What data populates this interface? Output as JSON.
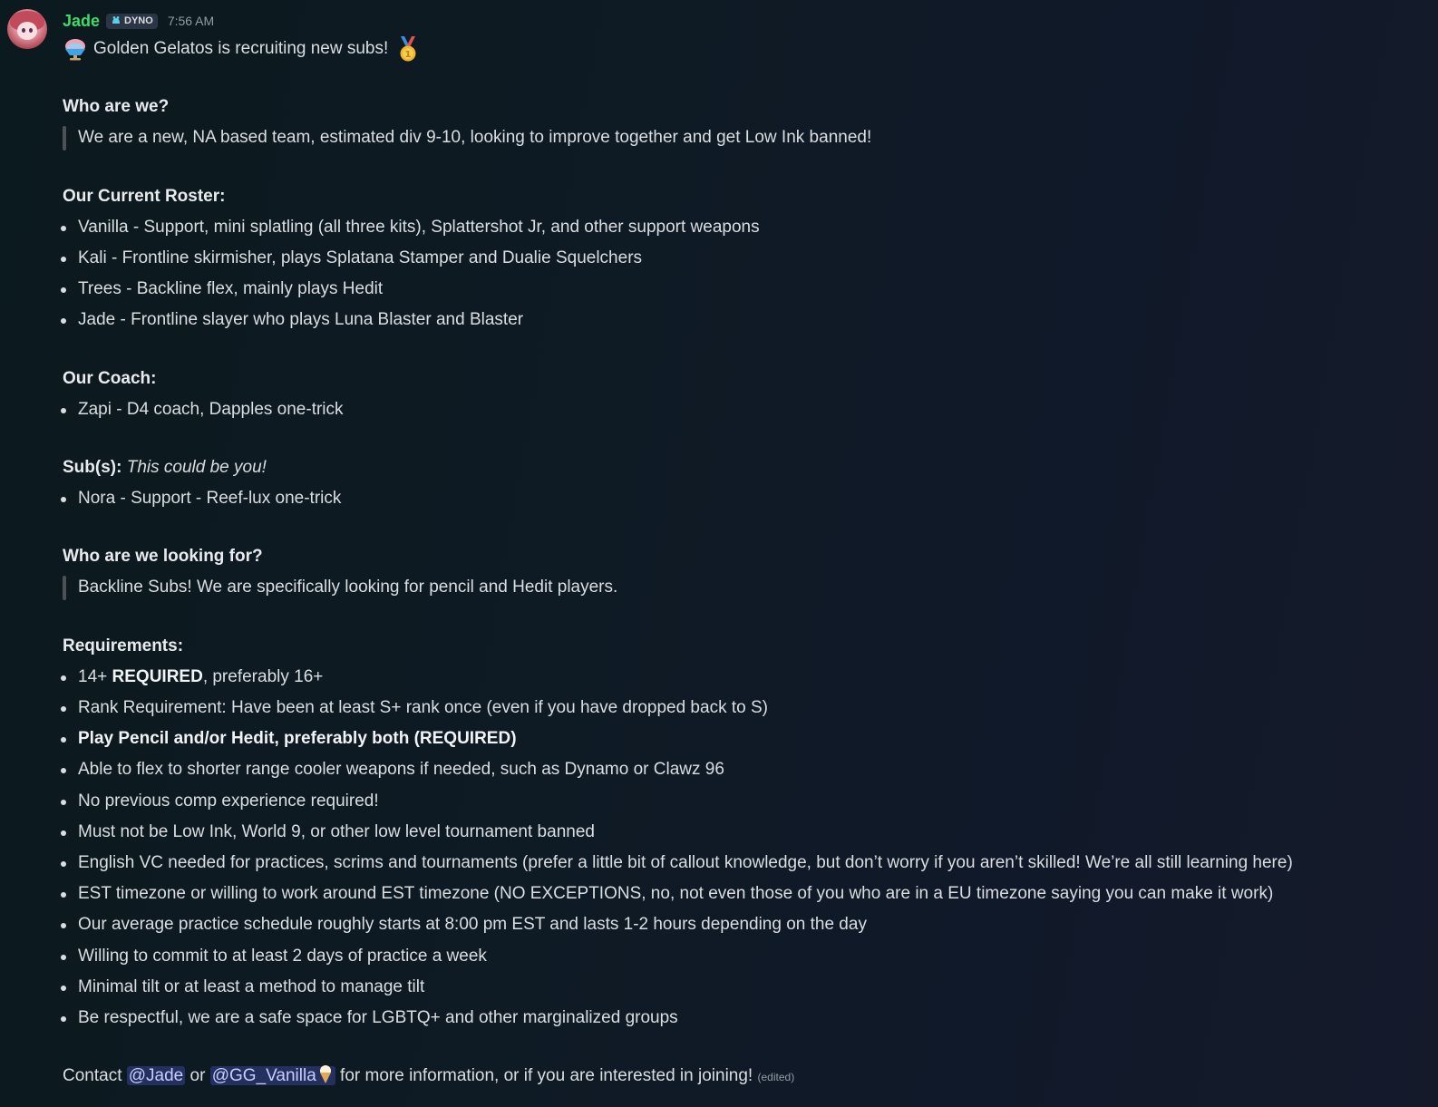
{
  "author": {
    "name": "Jade",
    "tag": "DYNO",
    "timestamp": "7:56 AM"
  },
  "message": {
    "intro": "Golden Gelatos is recruiting new subs!",
    "intro_emoji_left": "shaved-ice-icon",
    "intro_emoji_right": "gold-medal-icon",
    "who_heading": "Who are we?",
    "who_text": "We are a new, NA based team, estimated div 9-10, looking to improve together and get Low Ink banned!",
    "roster_heading": "Our Current Roster:",
    "roster": [
      "Vanilla - Support, mini splatling (all three kits), Splattershot Jr, and other support weapons",
      "Kali - Frontline skirmisher, plays Splatana Stamper and Dualie Squelchers",
      "Trees - Backline flex, mainly plays Hedit",
      "Jade - Frontline slayer who plays Luna Blaster and Blaster"
    ],
    "coach_heading": "Our Coach:",
    "coach": [
      "Zapi - D4 coach, Dapples one-trick"
    ],
    "subs_heading": "Sub(s):",
    "subs_italic": "This could be you!",
    "subs": [
      "Nora - Support - Reef-lux one-trick"
    ],
    "looking_heading": "Who are we looking for?",
    "looking_text": "Backline Subs! We are specifically looking for pencil and Hedit players.",
    "req_heading": "Requirements:",
    "req_age_prefix": "14+ ",
    "req_age_bold": "REQUIRED",
    "req_age_suffix": ", preferably 16+",
    "req_rank": "Rank Requirement: Have been at least S+ rank once (even if you have dropped back to S)",
    "req_weapons_bold": "Play Pencil and/or Hedit, preferably both (REQUIRED)",
    "requirements_rest": [
      "Able to flex to shorter range cooler weapons if needed, such as Dynamo or Clawz 96",
      "No previous comp experience required!",
      "Must not be Low Ink, World 9, or other low level tournament banned",
      "English VC needed for practices, scrims and tournaments (prefer a little bit of callout knowledge, but don’t worry if you aren’t skilled! We’re all still learning here)",
      "EST timezone or willing to work around EST timezone (NO EXCEPTIONS, no, not even those of you who are in a EU timezone saying you can make it work)",
      "Our average practice schedule roughly starts at 8:00 pm EST and lasts 1-2 hours depending on the day",
      "Willing to commit to at least 2 days of practice a week",
      "Minimal tilt or at least a method to manage tilt",
      "Be respectful, we are a safe space for LGBTQ+ and other marginalized groups"
    ],
    "contact_prefix": "Contact ",
    "mention_1": "@Jade",
    "contact_or": " or ",
    "mention_2": "@GG_Vanilla",
    "mention_2_emoji": "ice-cream-icon",
    "contact_suffix": " for more information, or if you are interested in joining!",
    "edited": "(edited)"
  },
  "colors": {
    "username": "#3ddc6a",
    "text": "#dbdee1",
    "mention_bg": "#3c4270",
    "timestamp": "#949ba4"
  }
}
